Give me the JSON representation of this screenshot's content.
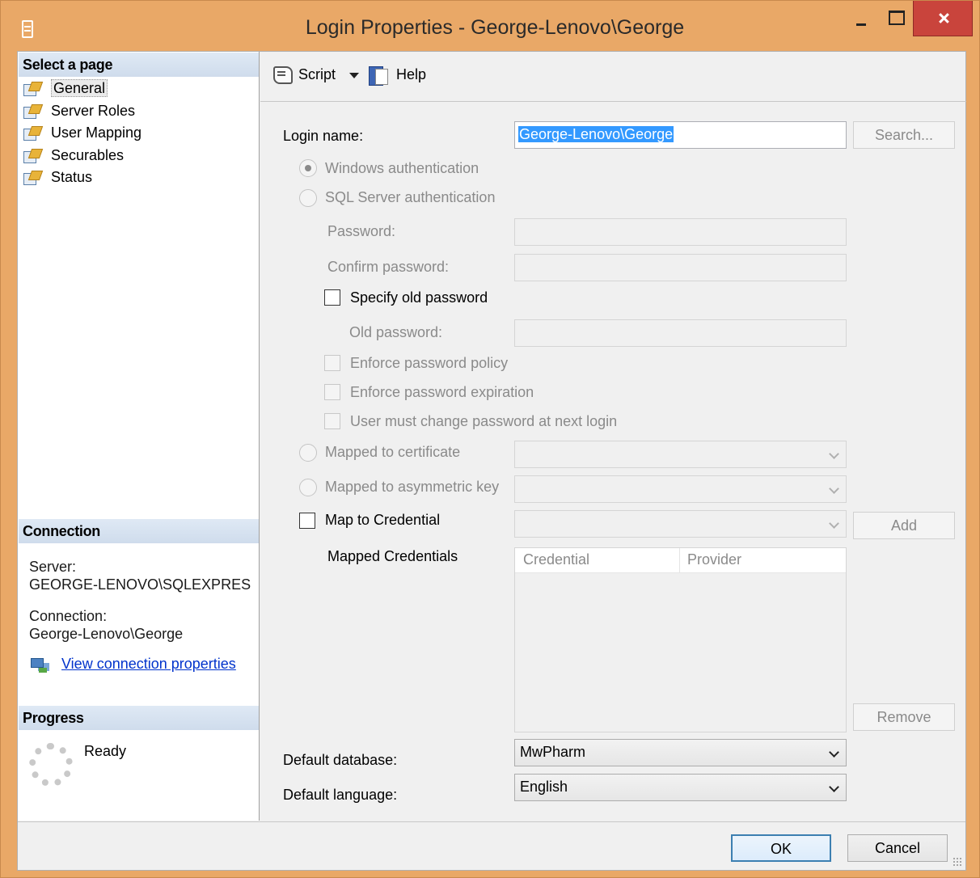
{
  "window": {
    "title": "Login Properties - George-Lenovo\\George"
  },
  "left": {
    "select_page_header": "Select a page",
    "pages": [
      {
        "label": "General",
        "selected": true
      },
      {
        "label": "Server Roles",
        "selected": false
      },
      {
        "label": "User Mapping",
        "selected": false
      },
      {
        "label": "Securables",
        "selected": false
      },
      {
        "label": "Status",
        "selected": false
      }
    ],
    "connection_header": "Connection",
    "server_label": "Server:",
    "server_value": "GEORGE-LENOVO\\SQLEXPRES",
    "connection_label": "Connection:",
    "connection_value": "George-Lenovo\\George",
    "view_connection_link": "View connection properties",
    "progress_header": "Progress",
    "progress_status": "Ready"
  },
  "toolbar": {
    "script_label": "Script",
    "help_label": "Help"
  },
  "form": {
    "login_name_label": "Login name:",
    "login_name_value": "George-Lenovo\\George",
    "search_button": "Search...",
    "windows_auth": "Windows authentication",
    "windows_auth_checked": true,
    "sql_auth": "SQL Server authentication",
    "password_label": "Password:",
    "confirm_password_label": "Confirm password:",
    "specify_old_password": "Specify old password",
    "old_password_label": "Old password:",
    "enforce_policy": "Enforce password policy",
    "enforce_expiration": "Enforce password expiration",
    "must_change": "User must change password at next login",
    "mapped_certificate": "Mapped to certificate",
    "mapped_asymmetric_key": "Mapped to asymmetric key",
    "map_to_credential": "Map to Credential",
    "add_button": "Add",
    "mapped_credentials_label": "Mapped Credentials",
    "grid_columns": [
      "Credential",
      "Provider"
    ],
    "remove_button": "Remove",
    "default_database_label": "Default database:",
    "default_database_value": "MwPharm",
    "default_language_label": "Default language:",
    "default_language_value": "English"
  },
  "footer": {
    "ok_button": "OK",
    "cancel_button": "Cancel"
  }
}
